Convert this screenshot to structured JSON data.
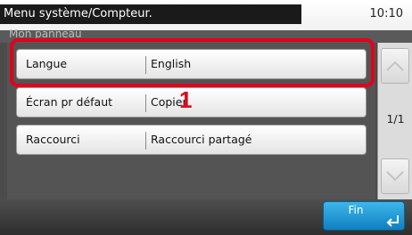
{
  "header": {
    "title": "Menu système/Compteur.",
    "clock": "10:10"
  },
  "subheader": {
    "label": "Mon panneau"
  },
  "rows": [
    {
      "label": "Langue",
      "value": "English"
    },
    {
      "label": "Écran pr défaut",
      "value": "Copier"
    },
    {
      "label": "Raccourci",
      "value": "Raccourci partagé"
    }
  ],
  "annotation": {
    "callout_number": "1",
    "highlight_color": "#e3001b"
  },
  "pagination": {
    "page": "1/1",
    "up_icon": "chevron-up-icon",
    "down_icon": "chevron-down-icon"
  },
  "footer": {
    "fin_label": "Fin",
    "fin_icon": "enter-return-icon",
    "fin_color": "#1a9ad6"
  }
}
